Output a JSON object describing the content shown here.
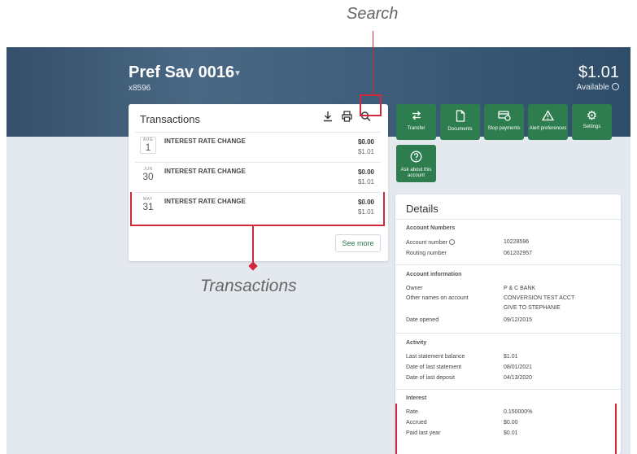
{
  "callouts": {
    "search": "Search",
    "transactions": "Transactions"
  },
  "account": {
    "name": "Pref Sav 0016",
    "number": "x8596",
    "balance": "$1.01",
    "balance_label": "Available"
  },
  "transactions": {
    "title": "Transactions",
    "items": [
      {
        "month": "AUG",
        "day": "1",
        "description": "INTEREST RATE CHANGE",
        "amount": "$0.00",
        "balance": "$1.01"
      },
      {
        "month": "JUN",
        "day": "30",
        "description": "INTEREST RATE CHANGE",
        "amount": "$0.00",
        "balance": "$1.01"
      },
      {
        "month": "MAY",
        "day": "31",
        "description": "INTEREST RATE CHANGE",
        "amount": "$0.00",
        "balance": "$1.01"
      }
    ],
    "see_more": "See more"
  },
  "actions": [
    {
      "icon": "transfer-icon",
      "label": "Transfer"
    },
    {
      "icon": "documents-icon",
      "label": "Documents"
    },
    {
      "icon": "stop-payments-icon",
      "label": "Stop payments"
    },
    {
      "icon": "alert-icon",
      "label": "Alert preferences"
    },
    {
      "icon": "gear-icon",
      "label": "Settings"
    },
    {
      "icon": "question-icon",
      "label": "Ask about this account"
    }
  ],
  "details": {
    "title": "Details",
    "account_numbers": {
      "heading": "Account Numbers",
      "account_number_label": "Account number",
      "account_number": "10228596",
      "routing_number_label": "Routing number",
      "routing_number": "061202957"
    },
    "account_info": {
      "heading": "Account information",
      "owner_label": "Owner",
      "owner": "P & C BANK",
      "other_names_label": "Other names on account",
      "other_names_1": "CONVERSION TEST ACCT",
      "other_names_2": "GIVE TO STEPHANIE",
      "date_opened_label": "Date opened",
      "date_opened": "09/12/2015"
    },
    "activity": {
      "heading": "Activity",
      "last_statement_balance_label": "Last statement balance",
      "last_statement_balance": "$1.01",
      "date_of_last_statement_label": "Date of last statement",
      "date_of_last_statement": "08/01/2021",
      "date_of_last_deposit_label": "Date of last deposit",
      "date_of_last_deposit": "04/13/2020"
    },
    "interest": {
      "heading": "Interest",
      "rate_label": "Rate",
      "rate": "0.150000%",
      "accrued_label": "Accrued",
      "accrued": "$0.00",
      "paid_last_year_label": "Paid last year",
      "paid_last_year": "$0.01"
    }
  },
  "colors": {
    "accent_green": "#2e7d4f",
    "highlight_red": "#d2283c",
    "hero_blue": "#3f5f7c",
    "page_bg": "#e4e9ef"
  }
}
